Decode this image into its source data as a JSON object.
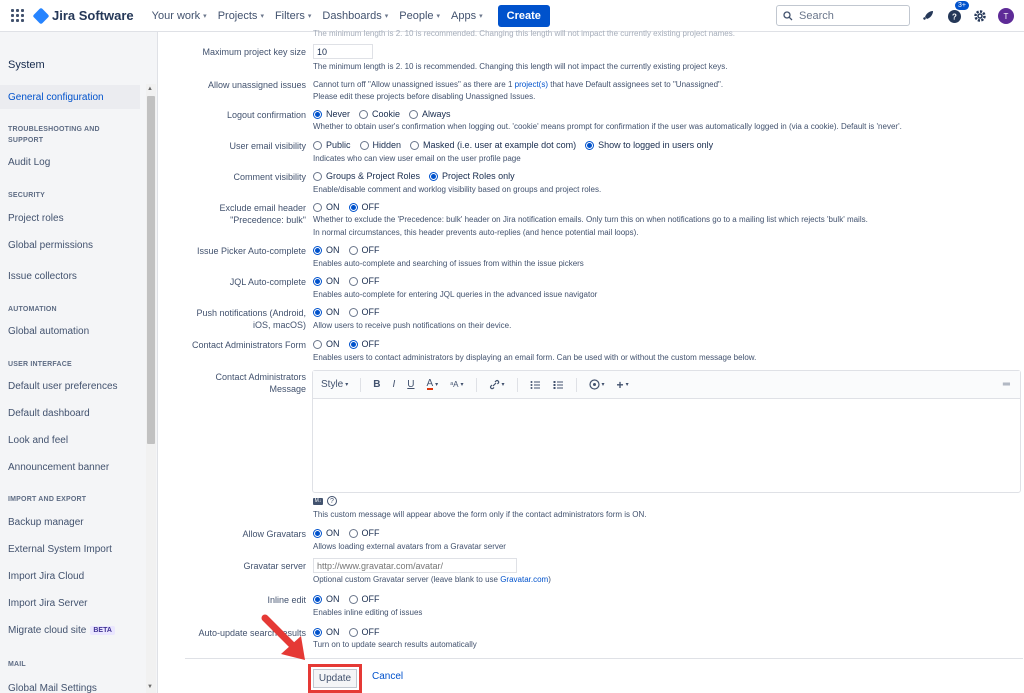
{
  "topbar": {
    "logo_text": "Jira Software",
    "nav": [
      "Your work",
      "Projects",
      "Filters",
      "Dashboards",
      "People",
      "Apps"
    ],
    "create_label": "Create",
    "search_placeholder": "Search",
    "notification_badge": "3+",
    "avatar_initial": "T"
  },
  "sidebar": {
    "heading": "System",
    "active_item": "General configuration",
    "sections": {
      "troubleshooting": "TROUBLESHOOTING AND SUPPORT",
      "security": "SECURITY",
      "automation": "AUTOMATION",
      "user_interface": "USER INTERFACE",
      "import_export": "IMPORT AND EXPORT",
      "mail": "MAIL"
    },
    "items": {
      "audit_log": "Audit Log",
      "project_roles": "Project roles",
      "global_permissions": "Global permissions",
      "issue_collectors": "Issue collectors",
      "global_automation": "Global automation",
      "default_user_prefs": "Default user preferences",
      "default_dashboard": "Default dashboard",
      "look_and_feel": "Look and feel",
      "announcement_banner": "Announcement banner",
      "backup_manager": "Backup manager",
      "external_import": "External System Import",
      "import_cloud": "Import Jira Cloud",
      "import_server": "Import Jira Server",
      "migrate_cloud": "Migrate cloud site",
      "global_mail": "Global Mail Settings"
    },
    "beta_badge": "BETA"
  },
  "settings": {
    "top_cut_text": "The minimum length is 2. 10 is recommended. Changing this length will not impact the currently existing project names.",
    "max_key": {
      "label": "Maximum project key size",
      "value": "10",
      "desc": "The minimum length is 2. 10 is recommended. Changing this length will not impact the currently existing project keys."
    },
    "unassigned": {
      "label": "Allow unassigned issues",
      "desc1_pre": "Cannot turn off \"Allow unassigned issues\" as there are 1 ",
      "desc1_link": "project(s)",
      "desc1_post": " that have Default assignees set to \"Unassigned\".",
      "desc2": "Please edit these projects before disabling Unassigned Issues."
    },
    "logout": {
      "label": "Logout confirmation",
      "options": [
        "Never",
        "Cookie",
        "Always"
      ],
      "desc": "Whether to obtain user's confirmation when logging out. 'cookie' means prompt for confirmation if the user was automatically logged in (via a cookie). Default is 'never'."
    },
    "email_visibility": {
      "label": "User email visibility",
      "options": [
        "Public",
        "Hidden",
        "Masked (i.e. user at example dot com)",
        "Show to logged in users only"
      ],
      "desc": "Indicates who can view user email on the user profile page"
    },
    "comment_visibility": {
      "label": "Comment visibility",
      "options": [
        "Groups & Project Roles",
        "Project Roles only"
      ],
      "desc": "Enable/disable comment and worklog visibility based on groups and project roles."
    },
    "exclude_header": {
      "label1": "Exclude email header",
      "label2": "\"Precedence: bulk\"",
      "on": "ON",
      "off": "OFF",
      "desc1": "Whether to exclude the 'Precedence: bulk' header on Jira notification emails. Only turn this on when notifications go to a mailing list which rejects 'bulk' mails.",
      "desc2": "In normal circumstances, this header prevents auto-replies (and hence potential mail loops)."
    },
    "issue_picker": {
      "label": "Issue Picker Auto-complete",
      "on": "ON",
      "off": "OFF",
      "desc": "Enables auto-complete and searching of issues from within the issue pickers"
    },
    "jql": {
      "label": "JQL Auto-complete",
      "on": "ON",
      "off": "OFF",
      "desc": "Enables auto-complete for entering JQL queries in the advanced issue navigator"
    },
    "push": {
      "label1": "Push notifications (Android,",
      "label2": "iOS, macOS)",
      "on": "ON",
      "off": "OFF",
      "desc": "Allow users to receive push notifications on their device."
    },
    "contact_form": {
      "label": "Contact Administrators Form",
      "on": "ON",
      "off": "OFF",
      "desc": "Enables users to contact administrators by displaying an email form. Can be used with or without the custom message below."
    },
    "contact_message": {
      "label1": "Contact Administrators",
      "label2": "Message",
      "style_label": "Style",
      "md_badge": "M↓",
      "help_glyph": "?",
      "desc": "This custom message will appear above the form only if the contact administrators form is ON."
    },
    "gravatars": {
      "label": "Allow Gravatars",
      "on": "ON",
      "off": "OFF",
      "desc": "Allows loading external avatars from a Gravatar server"
    },
    "gravatar_server": {
      "label": "Gravatar server",
      "placeholder": "http://www.gravatar.com/avatar/",
      "desc_pre": "Optional custom Gravatar server (leave blank to use ",
      "desc_link": "Gravatar.com",
      "desc_post": ")"
    },
    "inline_edit": {
      "label": "Inline edit",
      "on": "ON",
      "off": "OFF",
      "desc": "Enables inline editing of issues"
    },
    "auto_update": {
      "label": "Auto-update search results",
      "on": "ON",
      "off": "OFF",
      "desc": "Turn on to update search results automatically"
    }
  },
  "actions": {
    "update": "Update",
    "cancel": "Cancel"
  },
  "colors": {
    "accent": "#0052cc",
    "highlight": "#e53935"
  }
}
